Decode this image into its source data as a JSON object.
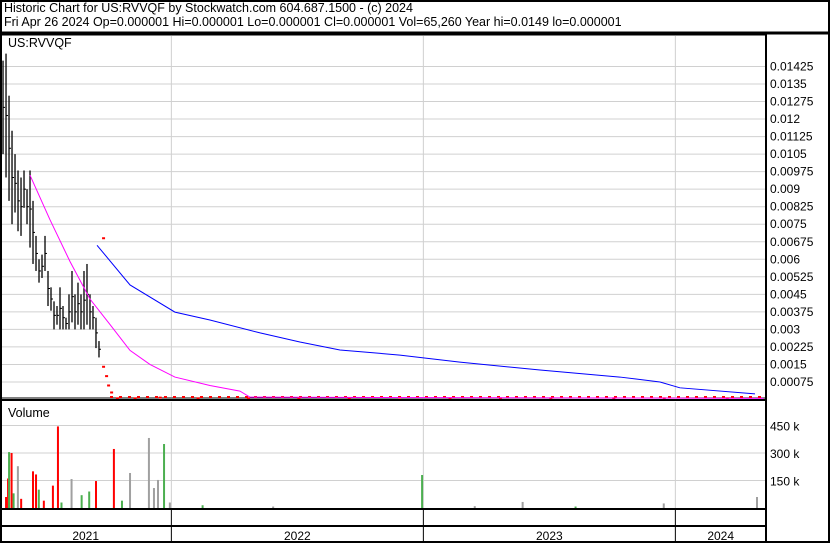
{
  "header": {
    "title": "Historic Chart for US:RVVQF by Stockwatch.com 604.687.1500 - (c) 2024",
    "quote": "Fri Apr 26 2024   Op=0.000001   Hi=0.000001   Lo=0.000001   Cl=0.000001   Vol=65,260   Year hi=0.0149   lo=0.000001"
  },
  "chart_data": {
    "type": "line",
    "symbol_label": "US:RVVQF",
    "volume_label": "Volume",
    "x_range": [
      2021.32,
      2024.36
    ],
    "price_ylim": [
      0,
      0.0149
    ],
    "price_ticks": [
      "0.01425",
      "0.0135",
      "0.01275",
      "0.012",
      "0.01125",
      "0.0105",
      "0.00975",
      "0.009",
      "0.00825",
      "0.0075",
      "0.00675",
      "0.006",
      "0.00525",
      "0.0045",
      "0.00375",
      "0.003",
      "0.00225",
      "0.0015",
      "0.00075"
    ],
    "volume_ticks": [
      {
        "label": "450 k",
        "value": 450
      },
      {
        "label": "300 k",
        "value": 300
      },
      {
        "label": "150 k",
        "value": 150
      }
    ],
    "years": [
      {
        "label": "2021",
        "start": 2021.32,
        "end": 2022.0
      },
      {
        "label": "2022",
        "start": 2022.0,
        "end": 2023.0
      },
      {
        "label": "2023",
        "start": 2023.0,
        "end": 2024.0
      },
      {
        "label": "2024",
        "start": 2024.0,
        "end": 2024.36
      }
    ],
    "price_bars": {
      "start": 2021.332,
      "step": 0.0119,
      "hi": [
        0.0145,
        0.0148,
        0.013,
        0.0115,
        0.0105,
        0.0098,
        0.0095,
        0.0098,
        0.009,
        0.0098,
        0.0085,
        0.007,
        0.006,
        0.0062,
        0.007,
        0.0055,
        0.0048,
        0.0042,
        0.004,
        0.0048,
        0.004,
        0.0035,
        0.0045,
        0.0055,
        0.0045,
        0.005,
        0.0045,
        0.0055,
        0.0058,
        0.0045,
        0.004,
        0.0035,
        0.0025
      ],
      "lo": [
        0.0105,
        0.0095,
        0.0085,
        0.0075,
        0.008,
        0.0072,
        0.007,
        0.0082,
        0.0075,
        0.0065,
        0.0058,
        0.0055,
        0.005,
        0.0052,
        0.0055,
        0.004,
        0.0038,
        0.003,
        0.0032,
        0.003,
        0.003,
        0.003,
        0.003,
        0.0033,
        0.003,
        0.0032,
        0.003,
        0.003,
        0.0032,
        0.003,
        0.003,
        0.0022,
        0.0018
      ]
    },
    "price_dots": [
      [
        2021.725,
        0.0069
      ],
      [
        2021.725,
        0.0014
      ],
      [
        2021.737,
        0.001
      ],
      [
        2021.745,
        0.0006
      ],
      [
        2021.757,
        0.0003
      ],
      [
        2021.78,
        5e-05
      ],
      [
        2021.85,
        5e-05
      ],
      [
        2021.95,
        8e-05
      ],
      [
        2022.1,
        5e-05
      ],
      [
        2022.3,
        5e-05
      ],
      [
        2022.5,
        5e-05
      ],
      [
        2022.7,
        5e-05
      ],
      [
        2022.9,
        8e-05
      ],
      [
        2023.1,
        5e-05
      ],
      [
        2023.3,
        5e-05
      ],
      [
        2023.5,
        5e-05
      ],
      [
        2023.75,
        5e-05
      ],
      [
        2023.95,
        5e-05
      ],
      [
        2024.2,
        5e-05
      ]
    ],
    "series": [
      {
        "name": "MA long",
        "color": "#0000ff",
        "points": [
          [
            2021.705,
            0.0066
          ],
          [
            2021.836,
            0.0049
          ],
          [
            2022.014,
            0.00374
          ],
          [
            2022.153,
            0.0034
          ],
          [
            2022.352,
            0.00285
          ],
          [
            2022.51,
            0.00246
          ],
          [
            2022.669,
            0.00212
          ],
          [
            2022.907,
            0.0019
          ],
          [
            2023.145,
            0.0016
          ],
          [
            2023.463,
            0.00126
          ],
          [
            2023.78,
            0.00096
          ],
          [
            2023.939,
            0.00075
          ],
          [
            2024.018,
            0.0005
          ],
          [
            2024.316,
            0.00024
          ]
        ]
      },
      {
        "name": "MA short",
        "color": "#ff00ff",
        "points": [
          [
            2021.439,
            0.0096
          ],
          [
            2021.518,
            0.0077
          ],
          [
            2021.598,
            0.0059
          ],
          [
            2021.677,
            0.0043
          ],
          [
            2021.757,
            0.0032
          ],
          [
            2021.836,
            0.0021
          ],
          [
            2021.915,
            0.0015
          ],
          [
            2022.014,
            0.00096
          ],
          [
            2022.153,
            0.0006
          ],
          [
            2022.272,
            0.00036
          ],
          [
            2022.312,
            0.0001
          ],
          [
            2024.35,
            5e-05
          ]
        ]
      }
    ],
    "volume": [
      [
        2021.34,
        60,
        "#ff0000"
      ],
      [
        2021.348,
        161,
        "#ff0000"
      ],
      [
        2021.352,
        305,
        "#4caf50"
      ],
      [
        2021.362,
        300,
        "#ff0000"
      ],
      [
        2021.37,
        80,
        "#4caf50"
      ],
      [
        2021.387,
        228,
        "#a0a0a0"
      ],
      [
        2021.4,
        50,
        "#ff0000"
      ],
      [
        2021.447,
        200,
        "#ff0000"
      ],
      [
        2021.459,
        183,
        "#ff0000"
      ],
      [
        2021.47,
        100,
        "#4caf50"
      ],
      [
        2021.49,
        40,
        "#ff0000"
      ],
      [
        2021.526,
        122,
        "#ff0000"
      ],
      [
        2021.546,
        445,
        "#ff0000"
      ],
      [
        2021.56,
        30,
        "#4caf50"
      ],
      [
        2021.6,
        158,
        "#a0a0a0"
      ],
      [
        2021.64,
        70,
        "#4caf50"
      ],
      [
        2021.697,
        147,
        "#ff0000"
      ],
      [
        2021.67,
        90,
        "#4caf50"
      ],
      [
        2021.768,
        322,
        "#ff0000"
      ],
      [
        2021.8,
        40,
        "#4caf50"
      ],
      [
        2021.832,
        191,
        "#a0a0a0"
      ],
      [
        2021.907,
        382,
        "#a0a0a0"
      ],
      [
        2021.927,
        109,
        "#a0a0a0"
      ],
      [
        2021.943,
        153,
        "#a0a0a0"
      ],
      [
        2021.967,
        349,
        "#4caf50"
      ],
      [
        2021.99,
        30,
        "#a0a0a0"
      ],
      [
        2022.12,
        15,
        "#4caf50"
      ],
      [
        2022.4,
        8,
        "#a0a0a0"
      ],
      [
        2022.991,
        180,
        "#4caf50"
      ],
      [
        2023.2,
        10,
        "#a0a0a0"
      ],
      [
        2023.39,
        33,
        "#a0a0a0"
      ],
      [
        2023.6,
        8,
        "#4caf50"
      ],
      [
        2023.95,
        25,
        "#a0a0a0"
      ],
      [
        2024.32,
        60,
        "#a0a0a0"
      ]
    ]
  }
}
